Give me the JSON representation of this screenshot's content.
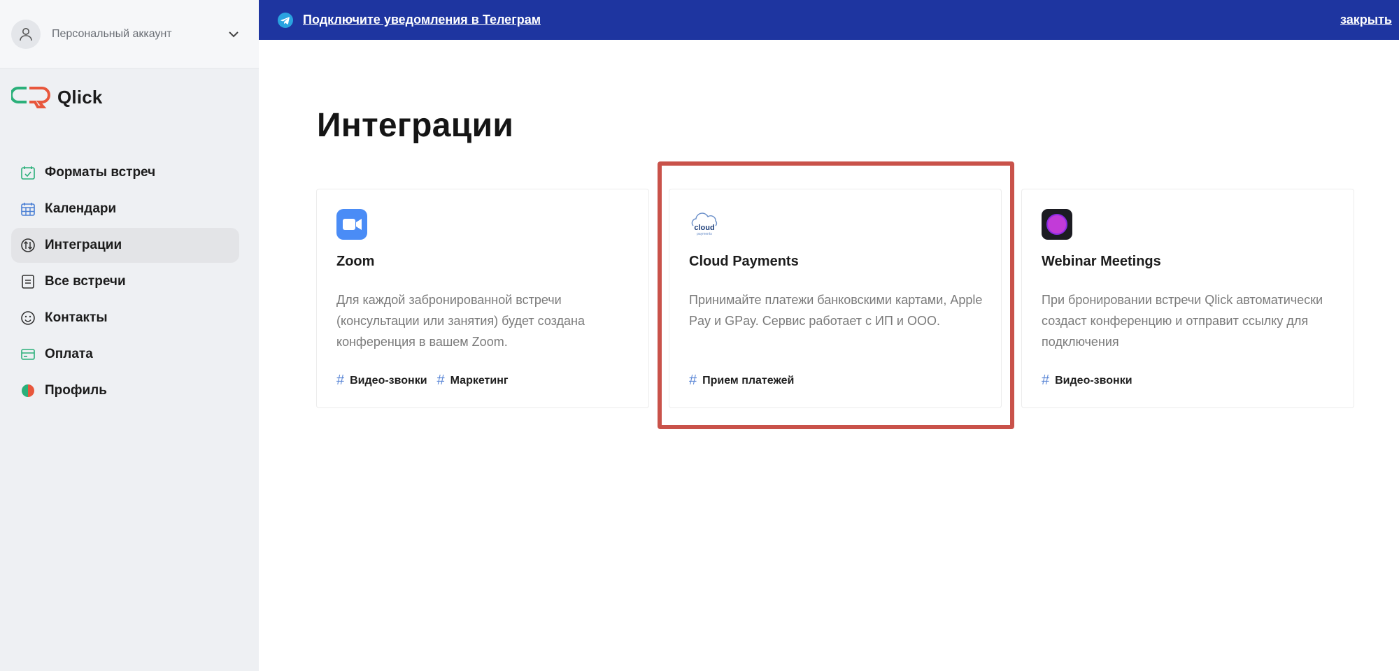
{
  "account": {
    "name": "Персональный аккаунт"
  },
  "logo": {
    "text": "Qlick"
  },
  "sidebar": {
    "items": [
      {
        "label": "Форматы встреч",
        "icon": "calendar-check-icon"
      },
      {
        "label": "Календари",
        "icon": "calendar-grid-icon"
      },
      {
        "label": "Интеграции",
        "icon": "integrations-icon"
      },
      {
        "label": "Все встречи",
        "icon": "list-icon"
      },
      {
        "label": "Контакты",
        "icon": "smiley-icon"
      },
      {
        "label": "Оплата",
        "icon": "card-icon"
      },
      {
        "label": "Профиль",
        "icon": "profile-dot-icon"
      }
    ],
    "active_index": 2
  },
  "banner": {
    "message": "Подключите уведомления в Телеграм",
    "close": "закрыть",
    "color": "#1e35a0"
  },
  "main": {
    "title": "Интеграции",
    "cards": [
      {
        "title": "Zoom",
        "icon": "zoom-icon",
        "description": "Для каждой забронированной встречи (консультации или занятия) будет создана конференция в вашем Zoom.",
        "tags": [
          "Видео-звонки",
          "Маркетинг"
        ]
      },
      {
        "title": "Cloud Payments",
        "icon": "cloud-payments-icon",
        "icon_text": "cloud",
        "icon_subtext": "payments",
        "description": "Принимайте платежи банковскими картами, Apple Pay и GPay. Сервис работает с ИП и ООО.",
        "tags": [
          "Прием платежей"
        ]
      },
      {
        "title": "Webinar Meetings",
        "icon": "webinar-icon",
        "description": "При бронировании встречи Qlick автоматически создаст конференцию и отправит ссылку для подключения",
        "tags": [
          "Видео-звонки"
        ]
      }
    ]
  },
  "colors": {
    "accent_green": "#2bb07a",
    "accent_red": "#e8573c",
    "tag_hash": "#5b87d6",
    "highlight": "#c9524a"
  }
}
